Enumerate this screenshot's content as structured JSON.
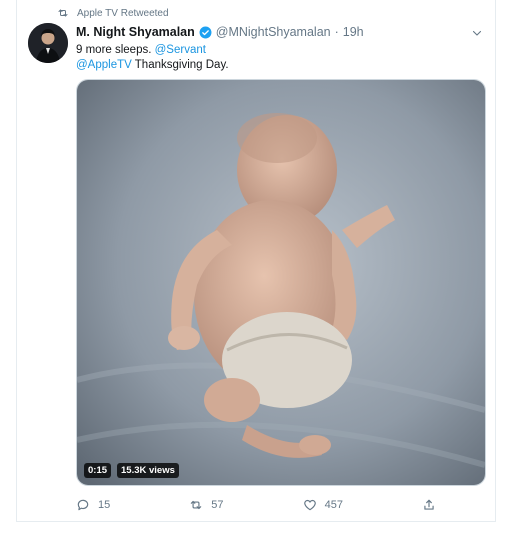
{
  "retweet": {
    "label": "Apple TV Retweeted"
  },
  "tweet": {
    "author_name": "M. Night Shyamalan",
    "handle": "@MNightShyamalan",
    "separator": "·",
    "time": "19h",
    "text_part1": "9 more sleeps. ",
    "mention1": "@Servant",
    "mention2": "@AppleTV",
    "text_part2": " Thanksgiving Day."
  },
  "media": {
    "duration": "0:15",
    "views": "15.3K views"
  },
  "actions": {
    "replies": "15",
    "retweets": "57",
    "likes": "457"
  },
  "colors": {
    "accent": "#1b95e0",
    "verified": "#1da1f2",
    "muted": "#657786"
  }
}
